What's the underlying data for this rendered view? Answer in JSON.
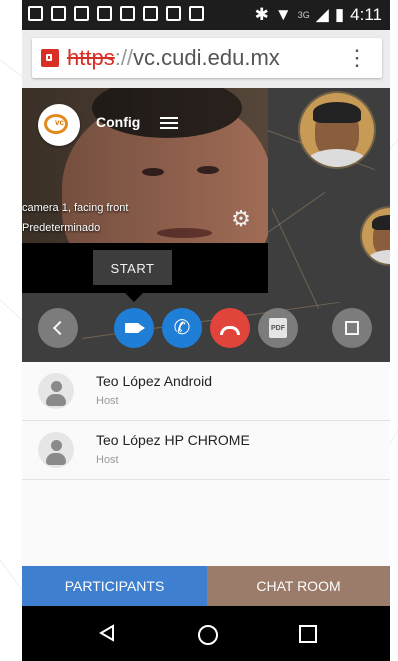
{
  "status_bar": {
    "network": "3G",
    "time": "4:11"
  },
  "address_bar": {
    "url_scheme": "https",
    "url_separator": "://",
    "url_host": "vc.cudi.edu.mx"
  },
  "config_panel": {
    "title": "Config",
    "camera_label": "camera 1, facing front",
    "mic_label": "Predeterminado",
    "start_label": "START"
  },
  "participants": [
    {
      "name": "Teo López Android",
      "role": "Host"
    },
    {
      "name": "Teo López HP CHROME",
      "role": "Host"
    }
  ],
  "tabs": {
    "participants": "PARTICIPANTS",
    "chat": "CHAT ROOM"
  },
  "colors": {
    "accent_blue": "#3f7fcf",
    "chat_tab": "#9b7b6a",
    "hangup_red": "#e0443a",
    "call_blue": "#1f7ed6"
  },
  "icons": [
    "gear-icon",
    "hamburger-icon",
    "video-camera-icon",
    "phone-icon",
    "hang-up-icon",
    "pdf-icon",
    "fullscreen-icon",
    "chevron-left-icon"
  ]
}
